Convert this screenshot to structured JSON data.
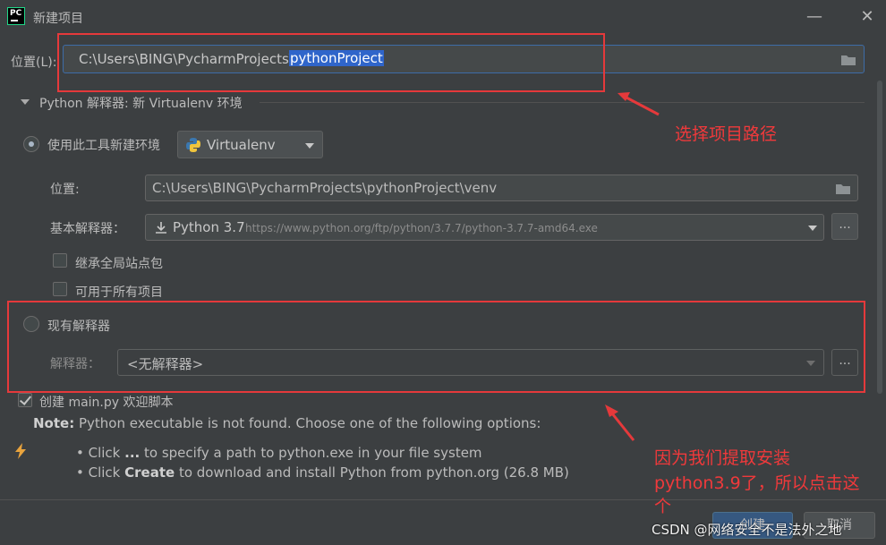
{
  "window": {
    "title": "新建项目",
    "minimize": "—",
    "close": "✕",
    "app_icon_text": "PC"
  },
  "location": {
    "label": "位置(L):",
    "path_prefix": "C:\\Users\\BING\\PycharmProjects\\",
    "path_selected": "pythonProject"
  },
  "interpreter_section": {
    "label": "Python 解释器: 新 Virtualenv 环境"
  },
  "new_env": {
    "radio_label": "使用此工具新建环境",
    "tool": "Virtualenv",
    "location_label": "位置:",
    "location_value": "C:\\Users\\BING\\PycharmProjects\\pythonProject\\venv",
    "base_label": "基本解释器：",
    "base_name": "Python 3.7",
    "base_url": "https://www.python.org/ftp/python/3.7.7/python-3.7.7-amd64.exe",
    "dots": "...",
    "inherit_label": "继承全局站点包",
    "all_projects_label": "可用于所有项目"
  },
  "existing": {
    "radio_label": "现有解释器",
    "interp_label": "解释器：",
    "interp_value": "<无解释器>",
    "dots": "..."
  },
  "create_main": {
    "label": "创建 main.py 欢迎脚本"
  },
  "note": {
    "prefix": "Note:",
    "text": " Python executable is not found. Choose one of the following options:",
    "line1_a": "Click ",
    "line1_b": "...",
    "line1_c": " to specify a path to python.exe in your file system",
    "line2_a": "Click ",
    "line2_b": "Create",
    "line2_c": " to download and install Python from python.org (26.8 MB)"
  },
  "annotations": {
    "select_path": "选择项目路径",
    "reason_line1": "因为我们提取安装",
    "reason_line2": "python3.9了，所以点击这",
    "reason_line3": "个"
  },
  "buttons": {
    "create": "创建",
    "cancel": "取消"
  },
  "watermark": "CSDN @网络安全不是法外之地",
  "colors": {
    "annotation_red": "#e5393b",
    "selection_blue": "#2f65ca",
    "background": "#3c3f41"
  }
}
